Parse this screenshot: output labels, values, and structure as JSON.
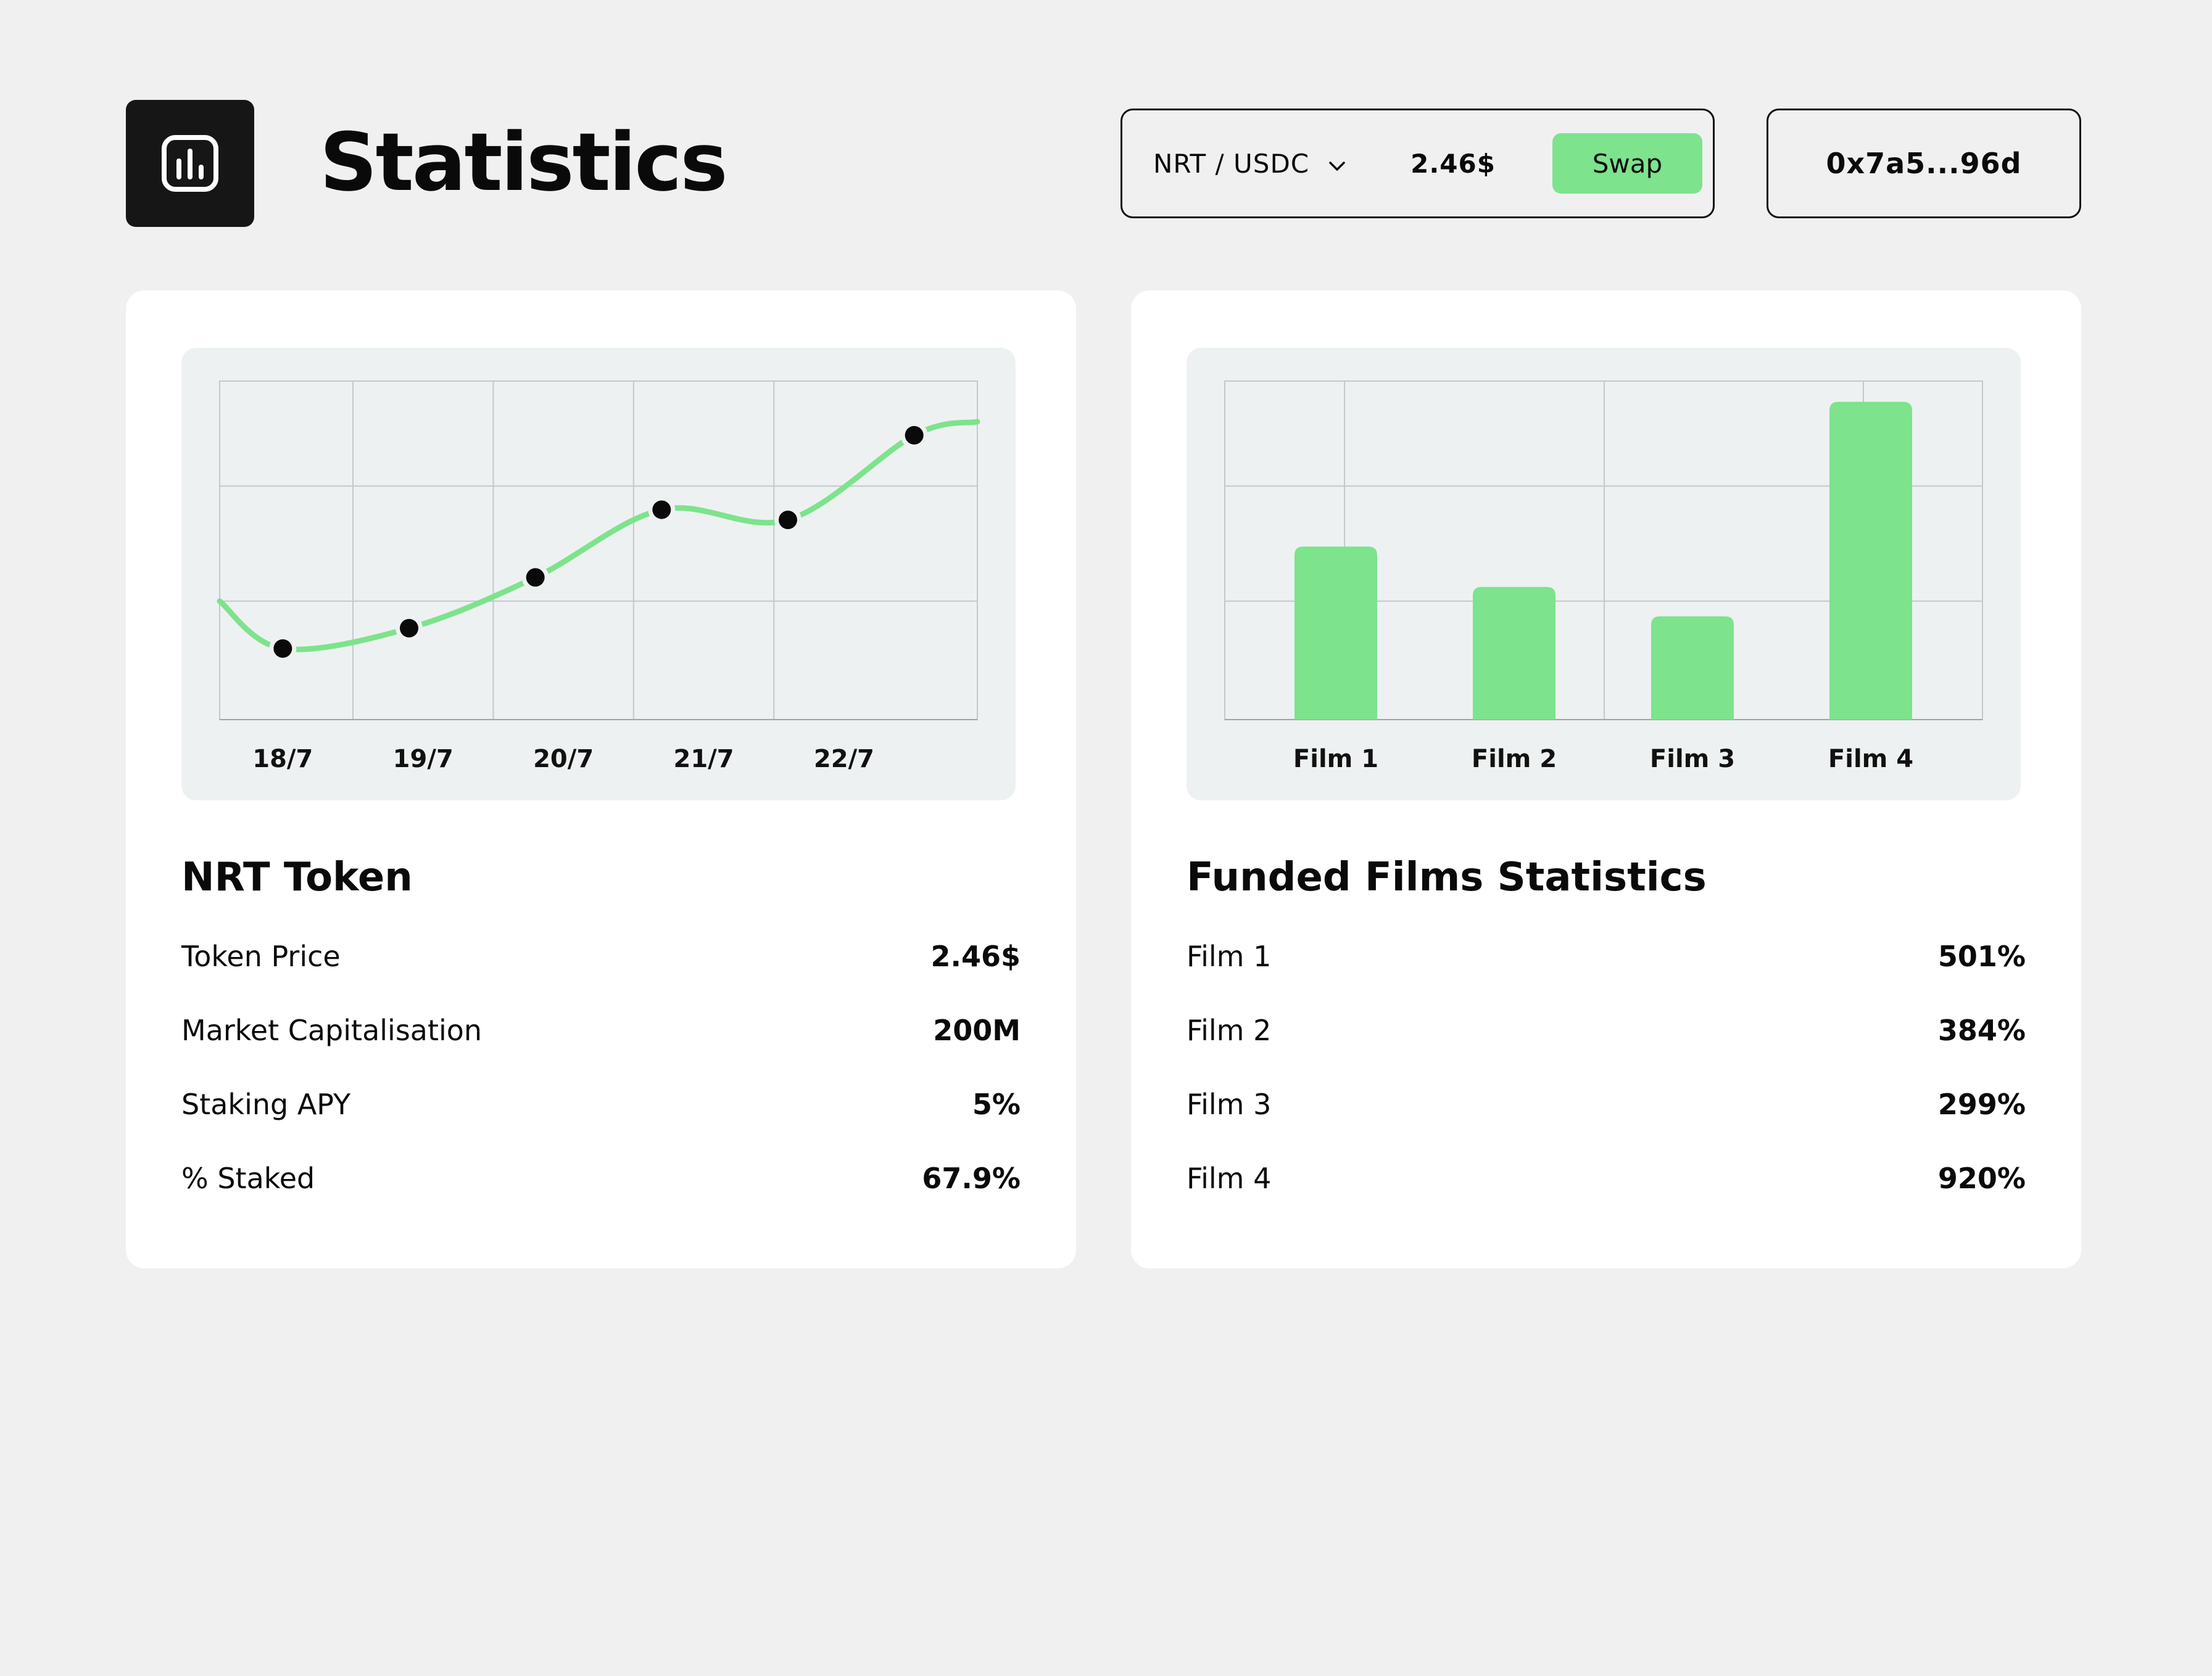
{
  "header": {
    "title": "Statistics",
    "logo_icon": "bar-chart-icon",
    "pair": "NRT / USDC",
    "price": "2.46$",
    "swap_label": "Swap",
    "wallet": "0x7a5...96d"
  },
  "colors": {
    "background": "#f1f0f1",
    "accent": "#7de38c",
    "card": "#ffffff",
    "chart_panel": "#eef1f1",
    "dark": "#161616"
  },
  "token_card": {
    "title": "NRT Token",
    "stats": [
      {
        "label": "Token Price",
        "value": "2.46$"
      },
      {
        "label": "Market Capitalisation",
        "value": "200M"
      },
      {
        "label": "Staking APY",
        "value": "5%"
      },
      {
        "label": "% Staked",
        "value": "67.9%"
      }
    ]
  },
  "films_card": {
    "title": "Funded Films Statistics",
    "stats": [
      {
        "label": "Film 1",
        "value": "501%"
      },
      {
        "label": "Film 2",
        "value": "384%"
      },
      {
        "label": "Film 3",
        "value": "299%"
      },
      {
        "label": "Film 4",
        "value": "920%"
      }
    ]
  },
  "chart_data": [
    {
      "type": "line",
      "title": "",
      "xlabel": "",
      "ylabel": "",
      "categories": [
        "18/7",
        "19/7",
        "20/7",
        "21/7",
        "22/7"
      ],
      "grid": true,
      "ylim": [
        0,
        1
      ],
      "series": [
        {
          "x": [
            17.55,
            18.0,
            18.9,
            19.8,
            20.7,
            21.6,
            22.5,
            22.95
          ],
          "y": [
            0.35,
            0.21,
            0.27,
            0.42,
            0.62,
            0.59,
            0.84,
            0.88
          ],
          "markers": [
            false,
            true,
            true,
            true,
            true,
            true,
            true,
            false
          ]
        }
      ]
    },
    {
      "type": "bar",
      "title": "",
      "xlabel": "",
      "ylabel": "",
      "categories": [
        "Film 1",
        "Film 2",
        "Film 3",
        "Film 4"
      ],
      "values": [
        501,
        384,
        299,
        920
      ],
      "ylim": [
        0,
        980
      ],
      "grid": true
    }
  ]
}
